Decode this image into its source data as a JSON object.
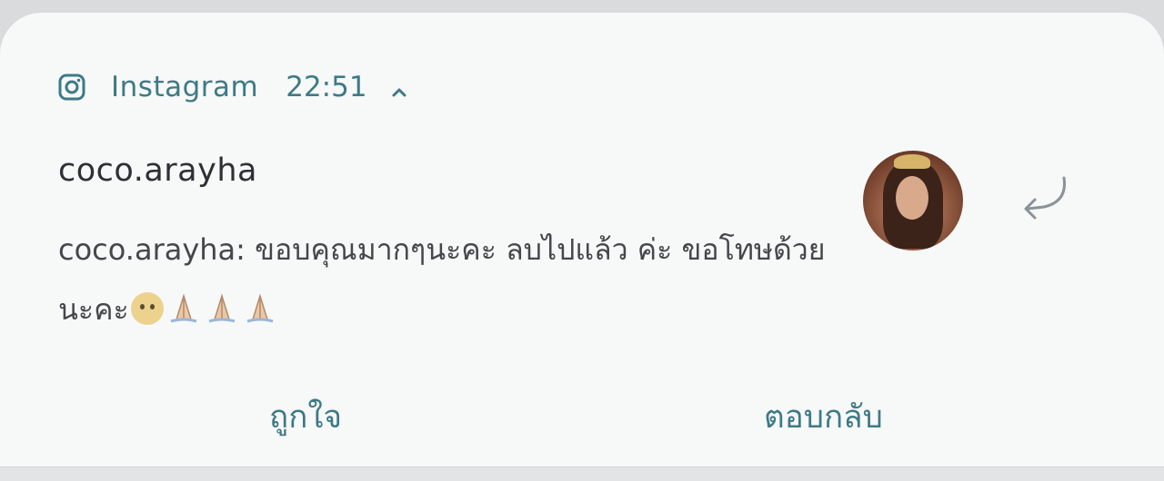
{
  "notification": {
    "app_icon": "instagram-icon",
    "app_name": "Instagram",
    "time": "22:51",
    "expand_icon": "chevron-up-icon",
    "sender": "coco.arayha",
    "message_text": "coco.arayha: ขอบคุณมากๆนะคะ ลบไปแล้ว ค่ะ ขอโทษด้วยนะคะ",
    "message_emojis": [
      "sad-face-emoji",
      "folded-hands-emoji",
      "folded-hands-emoji",
      "folded-hands-emoji"
    ],
    "avatar_icon": "profile-avatar",
    "reply_arrow_icon": "reply-arrow-icon"
  },
  "actions": {
    "like_label": "ถูกใจ",
    "reply_label": "ตอบกลับ"
  },
  "colors": {
    "accent": "#3e7a86",
    "card_background": "#f7f8f8",
    "text_primary": "#2d3134",
    "text_secondary": "#44484b"
  }
}
